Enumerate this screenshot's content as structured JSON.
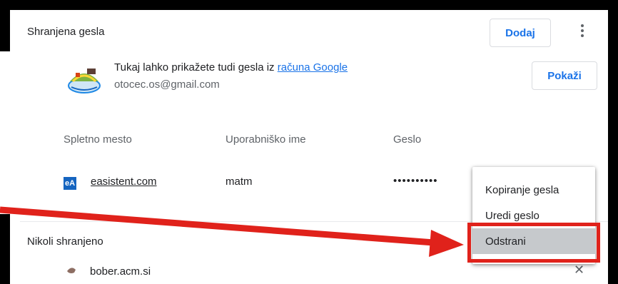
{
  "saved_section": {
    "title": "Shranjena gesla",
    "add_button": "Dodaj",
    "account": {
      "text_prefix": "Tukaj lahko prikažete tudi gesla iz ",
      "link_text": "računa Google",
      "email": "otocec.os@gmail.com",
      "show_button": "Pokaži"
    },
    "columns": {
      "site": "Spletno mesto",
      "username": "Uporabniško ime",
      "password": "Geslo"
    },
    "entries": [
      {
        "site": "easistent.com",
        "icon_text": "eA",
        "username": "matm",
        "password": "••••••••••"
      }
    ]
  },
  "never_section": {
    "title": "Nikoli shranjeno",
    "entries": [
      {
        "site": "bober.acm.si"
      }
    ]
  },
  "context_menu": {
    "items": [
      "Kopiranje gesla",
      "Uredi geslo",
      "Odstrani"
    ],
    "highlighted": "Odstrani"
  },
  "colors": {
    "accent": "#1a73e8",
    "annotation_red": "#e0221b",
    "site_icon": "#1565c0"
  }
}
